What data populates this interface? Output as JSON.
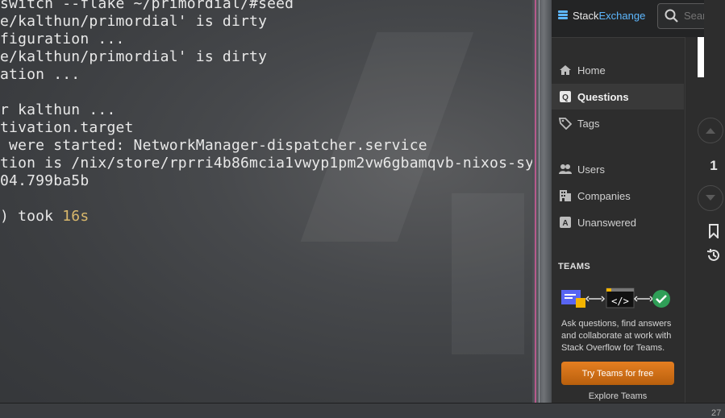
{
  "terminal": {
    "lines": [
      "switch --flake ~/primordial/#seed",
      "e/kalthun/primordial' is dirty",
      "figuration ...",
      "e/kalthun/primordial' is dirty",
      "ation ...",
      "",
      "r kalthun ...",
      "tivation.target",
      " were started: NetworkManager-dispatcher.service",
      "tion is /nix/store/rprri4b86mcia1vwyp1pm2vw6gbamqvb-nixos-sy",
      "04.799ba5b",
      "",
      ") took "
    ],
    "duration": "16s"
  },
  "header": {
    "logo_prefix": "Stack",
    "logo_suffix": "Exchange",
    "search_placeholder": "Search o"
  },
  "nav": {
    "items": [
      {
        "label": "Home",
        "icon": "home-icon"
      },
      {
        "label": "Questions",
        "icon": "questions-icon",
        "active": true
      },
      {
        "label": "Tags",
        "icon": "tag-icon"
      },
      {
        "label": "Users",
        "icon": "users-icon"
      },
      {
        "label": "Companies",
        "icon": "building-icon"
      },
      {
        "label": "Unanswered",
        "icon": "unanswered-icon"
      }
    ]
  },
  "teams": {
    "title": "TEAMS",
    "description": "Ask questions, find answers and collaborate at work with Stack Overflow for Teams.",
    "button_label": "Try Teams for free",
    "explore_label": "Explore Teams"
  },
  "vote": {
    "count": "1"
  },
  "bottom": {
    "peek_text": "27"
  },
  "colors": {
    "accent_blue": "#5eb8ff",
    "teams_button": "#e4781c",
    "duration_highlight": "#d9b86c",
    "check_green": "#2f9e57"
  }
}
